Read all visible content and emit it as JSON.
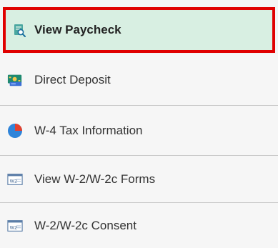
{
  "menu": {
    "items": [
      {
        "label": "View Paycheck",
        "icon": "paycheck-search-icon",
        "selected": true
      },
      {
        "label": "Direct Deposit",
        "icon": "money-icon",
        "selected": false
      },
      {
        "label": "W-4 Tax Information",
        "icon": "pie-chart-icon",
        "selected": false
      },
      {
        "label": "View W-2/W-2c Forms",
        "icon": "w2-form-icon",
        "selected": false
      },
      {
        "label": "W-2/W-2c Consent",
        "icon": "w2-form-icon",
        "selected": false
      }
    ],
    "w2_icon_text": "W2"
  },
  "colors": {
    "selected_bg": "#d8efe2",
    "highlight_border": "#e00000",
    "pie_blue": "#2f84d9",
    "pie_red": "#e2412e"
  }
}
